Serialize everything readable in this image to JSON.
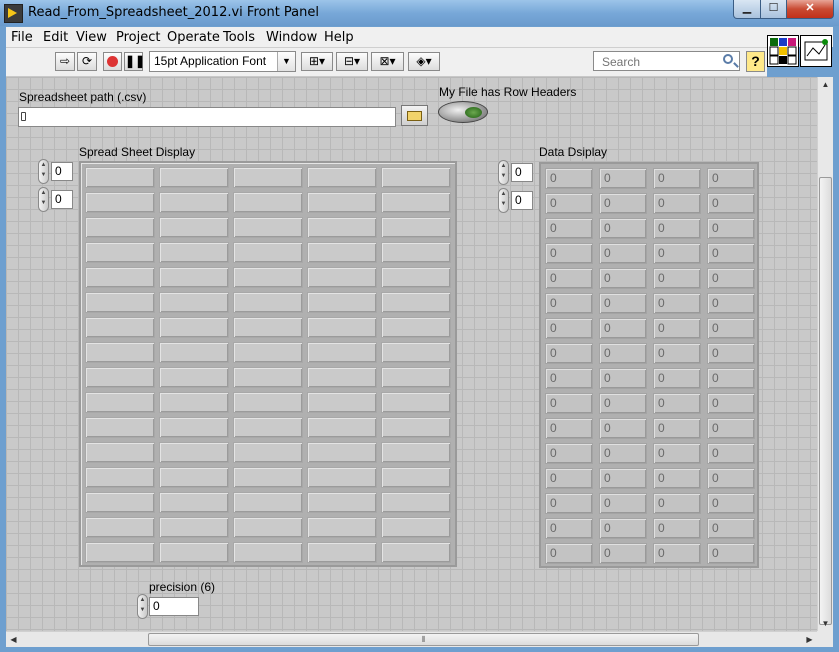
{
  "window": {
    "title": "Read_From_Spreadsheet_2012.vi Front Panel"
  },
  "menu": [
    "File",
    "Edit",
    "View",
    "Project",
    "Operate",
    "Tools",
    "Window",
    "Help"
  ],
  "toolbar": {
    "font": "15pt Application Font",
    "search_placeholder": "Search",
    "help_label": "?"
  },
  "controls": {
    "path_label": "Spreadsheet path (.csv)",
    "path_value": "",
    "toggle_label": "My File has Row Headers",
    "spreadsheet_label": "Spread Sheet Display",
    "spreadsheet_index_row": "0",
    "spreadsheet_index_col": "0",
    "data_label": "Data Dsiplay",
    "data_index_row": "0",
    "data_index_col": "0",
    "precision_label": "precision (6)",
    "precision_value": "0"
  },
  "data_cells": [
    "0",
    "0",
    "0",
    "0"
  ]
}
